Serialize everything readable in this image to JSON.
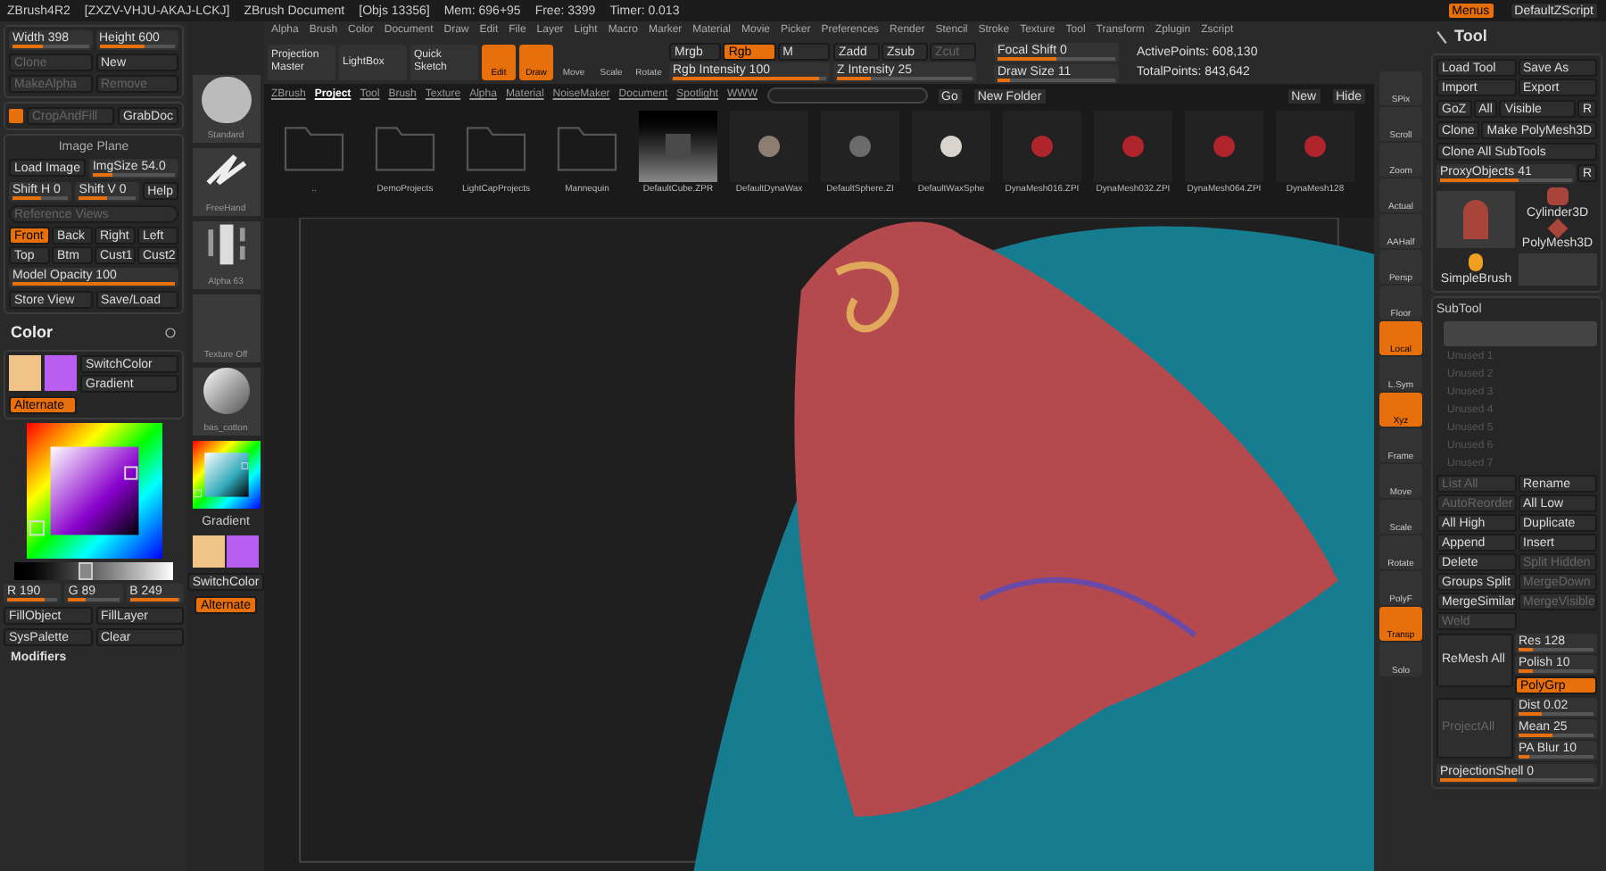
{
  "title_bar": {
    "items": [
      "ZBrush4R2",
      "[ZXZV-VHJU-AKAJ-LCKJ]",
      "ZBrush Document",
      "[Objs 13356]",
      "Mem: 696+95",
      "Free: 3399",
      "Timer: 0.013"
    ],
    "buttons": [
      {
        "label": "Menus",
        "selected": true
      },
      {
        "label": "DefaultZScript",
        "selected": false
      }
    ]
  },
  "menu": [
    "Alpha",
    "Brush",
    "Color",
    "Document",
    "Draw",
    "Edit",
    "File",
    "Layer",
    "Light",
    "Macro",
    "Marker",
    "Material",
    "Movie",
    "Picker",
    "Preferences",
    "Render",
    "Stencil",
    "Stroke",
    "Texture",
    "Tool",
    "Transform",
    "Zplugin",
    "Zscript"
  ],
  "toolbar": {
    "buttons": [
      "Projection Master",
      "LightBox",
      "Quick Sketch"
    ],
    "modes": [
      {
        "label": "Edit",
        "selected": true
      },
      {
        "label": "Draw",
        "selected": true
      },
      {
        "label": "Move",
        "selected": false
      },
      {
        "label": "Scale",
        "selected": false
      },
      {
        "label": "Rotate",
        "selected": false
      }
    ],
    "color_modes": [
      {
        "label": "Mrgb",
        "selected": false
      },
      {
        "label": "Rgb",
        "selected": true
      },
      {
        "label": "M",
        "selected": false
      }
    ],
    "z_modes": [
      {
        "label": "Zadd",
        "disabled": false
      },
      {
        "label": "Zsub",
        "disabled": false
      },
      {
        "label": "Zcut",
        "disabled": true
      }
    ],
    "sliders": [
      {
        "label": "Rgb Intensity 100",
        "level": 0.95
      },
      {
        "label": "Z Intensity 25",
        "level": 0.25
      },
      {
        "label": "Focal Shift 0",
        "level": 0.5
      },
      {
        "label": "Draw Size 11",
        "level": 0.1
      }
    ],
    "stats": [
      "ActivePoints: 608,130",
      "TotalPoints: 843,642"
    ]
  },
  "document_panel": {
    "sliders": [
      {
        "label": "Width 398",
        "level": 0.4
      },
      {
        "label": "Height 600",
        "level": 0.6
      }
    ],
    "buttons": [
      {
        "label": "Clone",
        "disabled": true
      },
      {
        "label": "New",
        "disabled": false
      },
      {
        "label": "MakeAlpha",
        "disabled": true
      },
      {
        "label": "Remove",
        "disabled": true
      }
    ],
    "crop": {
      "label": "CropAndFill",
      "disabled": true
    },
    "grab": "GrabDoc"
  },
  "image_plane": {
    "title": "Image Plane",
    "load": "Load Image",
    "size": {
      "label": "ImgSize 54.0",
      "level": 0.25
    },
    "shifts": [
      {
        "label": "Shift H 0",
        "level": 0.5
      },
      {
        "label": "Shift V 0",
        "level": 0.5
      }
    ],
    "help": "Help",
    "reference": "Reference Views",
    "views": [
      {
        "label": "Front",
        "selected": true
      },
      {
        "label": "Back",
        "selected": false
      },
      {
        "label": "Right",
        "selected": false
      },
      {
        "label": "Left",
        "selected": false
      },
      {
        "label": "Top",
        "selected": false
      },
      {
        "label": "Btm",
        "selected": false
      },
      {
        "label": "Cust1",
        "selected": false
      },
      {
        "label": "Cust2",
        "selected": false
      }
    ],
    "opacity": {
      "label": "Model Opacity 100",
      "level": 1
    },
    "buttons": [
      "Store View",
      "Save/Load"
    ]
  },
  "color": {
    "title": "Color",
    "value_slider": {
      "level": 0.45
    },
    "switch": "SwitchColor",
    "gradient": "Gradient",
    "alternate": {
      "label": "Alternate",
      "selected": true
    },
    "channels": [
      {
        "label": "R 190",
        "level": 0.75
      },
      {
        "label": "G 89",
        "level": 0.35
      },
      {
        "label": "B 249",
        "level": 0.97
      }
    ],
    "buttons": [
      "FillObject",
      "FillLayer",
      "SysPalette",
      "Clear"
    ],
    "modifiers": "Modifiers"
  },
  "brush_column": {
    "items": [
      {
        "kind": "brush",
        "label": "Standard"
      },
      {
        "kind": "stroke",
        "label": "FreeHand"
      },
      {
        "kind": "alpha",
        "label": "Alpha 63"
      },
      {
        "kind": "texture",
        "label": "Texture Off"
      },
      {
        "kind": "material",
        "label": "bas_cotton"
      }
    ],
    "gradient": "Gradient",
    "switch": "SwitchColor",
    "alternate": {
      "label": "Alternate",
      "selected": true
    }
  },
  "lightbox": {
    "tabs": [
      {
        "label": "ZBrush",
        "selected": false
      },
      {
        "label": "Project",
        "selected": true
      },
      {
        "label": "Tool",
        "selected": false
      },
      {
        "label": "Brush",
        "selected": false
      },
      {
        "label": "Texture",
        "selected": false
      },
      {
        "label": "Alpha",
        "selected": false
      },
      {
        "label": "Material",
        "selected": false
      },
      {
        "label": "NoiseMaker",
        "selected": false
      },
      {
        "label": "Document",
        "selected": false
      },
      {
        "label": "Spotlight",
        "selected": false
      },
      {
        "label": "WWW",
        "selected": false
      }
    ],
    "go": "Go",
    "new_folder": "New Folder",
    "new": "New",
    "hide": "Hide",
    "items": [
      {
        "kind": "folder",
        "label": ".."
      },
      {
        "kind": "folder",
        "label": "DemoProjects"
      },
      {
        "kind": "folder",
        "label": "LightCapProjects"
      },
      {
        "kind": "folder",
        "label": "Mannequin"
      },
      {
        "kind": "cube",
        "label": "DefaultCube.ZPR",
        "color": "#4a4a4a"
      },
      {
        "kind": "sphere",
        "label": "DefaultDynaWax",
        "color": "#8c7f72"
      },
      {
        "kind": "sphere",
        "label": "DefaultSphere.ZI",
        "color": "#6b6b6b"
      },
      {
        "kind": "sphere",
        "label": "DefaultWaxSphe",
        "color": "#d8d4cc"
      },
      {
        "kind": "sphere",
        "label": "DynaMesh016.ZPI",
        "color": "#b0242c"
      },
      {
        "kind": "sphere",
        "label": "DynaMesh032.ZPI",
        "color": "#b0242c"
      },
      {
        "kind": "sphere",
        "label": "DynaMesh064.ZPI",
        "color": "#b0242c"
      },
      {
        "kind": "sphere",
        "label": "DynaMesh128",
        "color": "#b0242c"
      }
    ]
  },
  "view_strip": [
    {
      "label": "SPix",
      "on": false
    },
    {
      "label": "Scroll",
      "on": false
    },
    {
      "label": "Zoom",
      "on": false
    },
    {
      "label": "Actual",
      "on": false
    },
    {
      "label": "AAHalf",
      "on": false
    },
    {
      "label": "Persp",
      "on": false
    },
    {
      "label": "Floor",
      "on": false
    },
    {
      "label": "Local",
      "on": true
    },
    {
      "label": "L.Sym",
      "on": false
    },
    {
      "label": "Xyz",
      "on": true
    },
    {
      "label": "Frame",
      "on": false
    },
    {
      "label": "Move",
      "on": false
    },
    {
      "label": "Scale",
      "on": false
    },
    {
      "label": "Rotate",
      "on": false
    },
    {
      "label": "PolyF",
      "on": false
    },
    {
      "label": "Transp",
      "on": true
    },
    {
      "label": "Solo",
      "on": false
    }
  ],
  "tool_panel": {
    "title": "Tool",
    "buttons": [
      "Load Tool",
      "Save As",
      "Import",
      "Export"
    ],
    "goz": [
      "GoZ",
      "All",
      "Visible",
      "R"
    ],
    "clone": [
      "Clone",
      "Make PolyMesh3D"
    ],
    "clone_all": "Clone All SubTools",
    "proxy": {
      "label": "ProxyObjects 41",
      "level": 0.6
    },
    "proxy_r": "R",
    "tools": [
      "Cylinder3D",
      "PolyMesh3D",
      "SimpleBrush"
    ]
  },
  "subtool": {
    "title": "SubTool",
    "slots": [
      {
        "label": "Unused 1"
      },
      {
        "label": "Unused 2"
      },
      {
        "label": "Unused 3"
      },
      {
        "label": "Unused 4"
      },
      {
        "label": "Unused 5"
      },
      {
        "label": "Unused 6"
      },
      {
        "label": "Unused 7"
      }
    ],
    "buttons": [
      {
        "label": "List All",
        "disabled": true
      },
      {
        "label": "Rename",
        "disabled": false
      },
      {
        "label": "AutoReorder",
        "disabled": true
      },
      {
        "label": "All Low",
        "disabled": false
      },
      {
        "label": "All High",
        "disabled": false
      },
      {
        "label": "Duplicate",
        "disabled": false
      },
      {
        "label": "Append",
        "disabled": false
      },
      {
        "label": "Insert",
        "disabled": false
      },
      {
        "label": "Delete",
        "disabled": false
      },
      {
        "label": "Split Hidden",
        "disabled": true
      },
      {
        "label": "Groups Split",
        "disabled": false
      },
      {
        "label": "MergeDown",
        "disabled": true
      },
      {
        "label": "MergeSimilar",
        "disabled": false
      },
      {
        "label": "MergeVisible",
        "disabled": true
      },
      {
        "label": "Weld",
        "disabled": true
      }
    ],
    "remesh": "ReMesh All",
    "remesh_sliders": [
      {
        "label": "Res 128",
        "level": 0.2
      },
      {
        "label": "Polish 10",
        "level": 0.2
      }
    ],
    "polygrp": {
      "label": "PolyGrp",
      "selected": true
    },
    "project_all": {
      "label": "ProjectAll",
      "disabled": true
    },
    "project_sliders": [
      {
        "label": "Dist 0.02",
        "level": 0.3
      },
      {
        "label": "Mean 25",
        "level": 0.45
      },
      {
        "label": "PA Blur 10",
        "level": 0.15
      }
    ],
    "shell": {
      "label": "ProjectionShell 0",
      "level": 0.5
    }
  }
}
